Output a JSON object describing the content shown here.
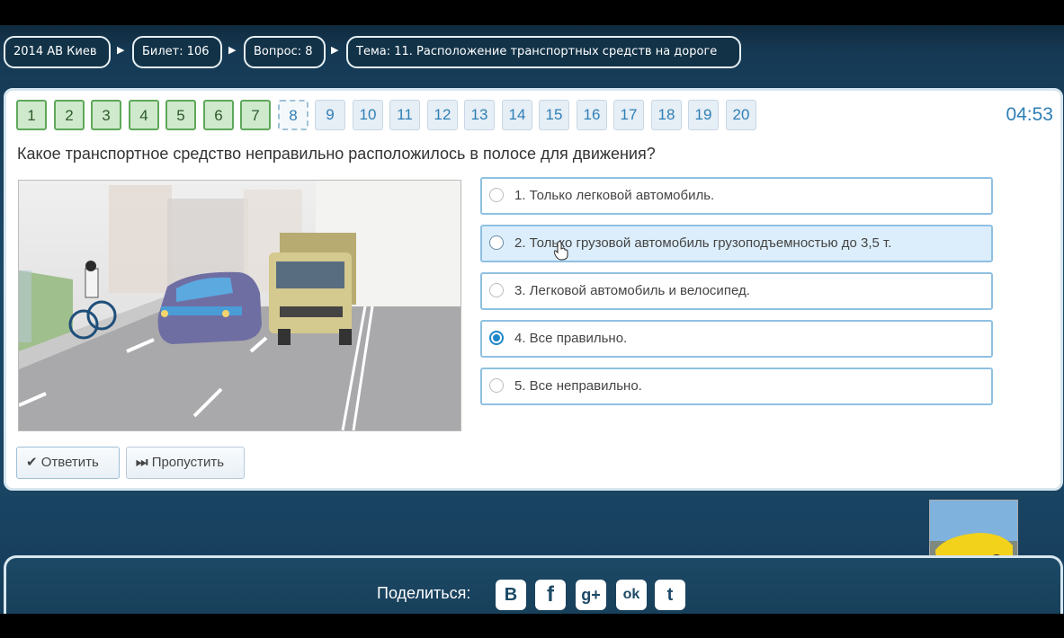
{
  "breadcrumb": {
    "edition": "2014 АВ Киев",
    "ticket": "Билет: 106",
    "question": "Вопрос: 8",
    "topic": "Тема: 11. Расположение транспортных средств на дороге"
  },
  "question_nav": {
    "numbers": [
      "1",
      "2",
      "3",
      "4",
      "5",
      "6",
      "7",
      "8",
      "9",
      "10",
      "11",
      "12",
      "13",
      "14",
      "15",
      "16",
      "17",
      "18",
      "19",
      "20"
    ],
    "answered_count": 7,
    "current": "8"
  },
  "timer": "04:53",
  "question_text": "Какое транспортное средство неправильно расположилось в полосе для движения?",
  "answers": [
    {
      "label": "1. Только легковой автомобиль.",
      "selected": false,
      "hover": false
    },
    {
      "label": "2. Только грузовой автомобиль грузоподъемностью до 3,5 т.",
      "selected": false,
      "hover": true
    },
    {
      "label": "3. Легковой автомобиль и велосипед.",
      "selected": false,
      "hover": false
    },
    {
      "label": "4. Все правильно.",
      "selected": true,
      "hover": false
    },
    {
      "label": "5. Все неправильно.",
      "selected": false,
      "hover": false
    }
  ],
  "buttons": {
    "answer": "Ответить",
    "skip": "Пропустить"
  },
  "footer": {
    "share_label": "Поделиться:",
    "social": [
      "В",
      "f",
      "g+",
      "ok",
      "t"
    ]
  },
  "colors": {
    "accent": "#2e7fb6",
    "answered_green": "#cfe9cc",
    "page_background": "#1b4868"
  }
}
